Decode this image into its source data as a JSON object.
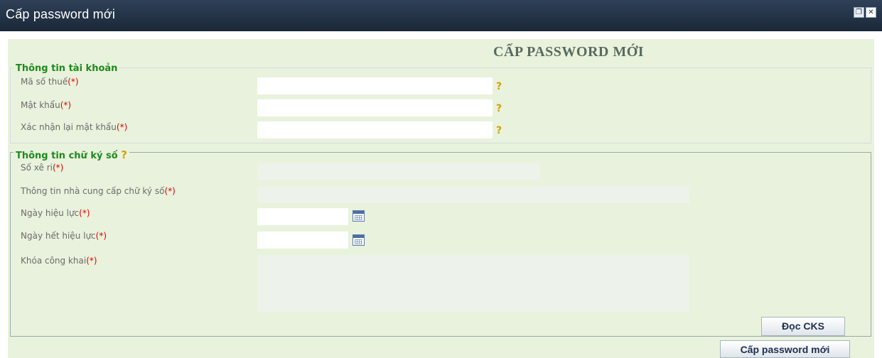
{
  "window": {
    "title": "Cấp password mới",
    "restore_icon": "restore-window-icon",
    "close_icon": "close-window-icon"
  },
  "page": {
    "heading": "CẤP PASSWORD MỚI",
    "required_marker": "(*)",
    "help_marker": "?"
  },
  "account_info": {
    "legend": "Thông tin tài khoản",
    "fields": {
      "tax_code": {
        "label": "Mã số thuế",
        "value": ""
      },
      "password": {
        "label": "Mật khẩu",
        "value": ""
      },
      "confirm_password": {
        "label": "Xác nhận lại mật khẩu",
        "value": ""
      }
    }
  },
  "signature_info": {
    "legend": "Thông tin chữ ký số",
    "fields": {
      "serial": {
        "label": "Số xê ri",
        "value": ""
      },
      "provider": {
        "label": "Thông tin nhà cung cấp chữ ký số",
        "value": ""
      },
      "valid_from": {
        "label": "Ngày hiệu lực",
        "value": ""
      },
      "valid_to": {
        "label": "Ngày hết hiệu lực",
        "value": ""
      },
      "public_key": {
        "label": "Khóa công khai",
        "value": ""
      }
    },
    "read_button": "Đọc CKS"
  },
  "submit_button": "Cấp password mới",
  "colors": {
    "titlebar": "#2a3a4f",
    "panel": "#e9f2dc",
    "legend_text": "#1d8a1d",
    "required": "#e00000",
    "help": "#d6a000"
  }
}
